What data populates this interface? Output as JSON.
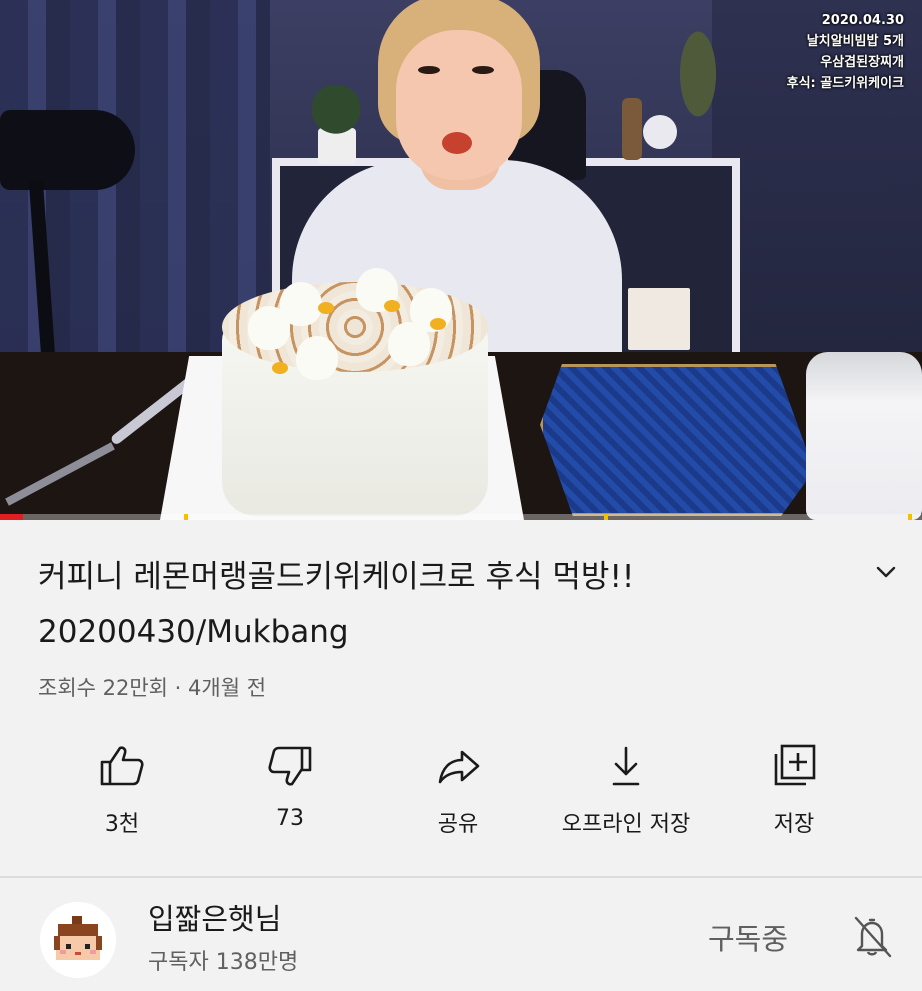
{
  "video": {
    "overlay": {
      "date": "2020.04.30",
      "line1": "날치알비빔밥 5개",
      "line2": "우삼겹된장찌개",
      "line3": "후식: 골드키위케이크"
    },
    "progress_fraction": 0.025,
    "colors": {
      "progress": "#e02020",
      "ad_marker": "#f2c200"
    }
  },
  "details": {
    "title": "커피니 레몬머랭골드키위케이크로 후식 먹방!! 20200430/Mukbang",
    "meta": "조회수 22만회 · 4개월 전",
    "expand_icon": "chevron-down-icon"
  },
  "actions": [
    {
      "id": "like",
      "icon": "thumbs-up-icon",
      "label": "3천"
    },
    {
      "id": "dislike",
      "icon": "thumbs-down-icon",
      "label": "73"
    },
    {
      "id": "share",
      "icon": "share-icon",
      "label": "공유"
    },
    {
      "id": "download",
      "icon": "download-icon",
      "label": "오프라인 저장"
    },
    {
      "id": "save",
      "icon": "add-to-playlist-icon",
      "label": "저장"
    }
  ],
  "channel": {
    "name": "입짧은햇님",
    "subscribers": "구독자 138만명",
    "subscribe_status": "구독중",
    "bell_icon": "bell-off-icon",
    "avatar_icon": "channel-avatar-icon"
  }
}
